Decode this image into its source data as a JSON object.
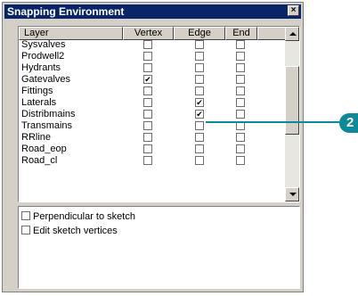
{
  "window": {
    "title": "Snapping Environment",
    "close_label": "×"
  },
  "columns": [
    "Layer",
    "Vertex",
    "Edge",
    "End"
  ],
  "layers": [
    {
      "name": "Sysvalves",
      "vertex": false,
      "edge": false,
      "end": false
    },
    {
      "name": "Prodwell2",
      "vertex": false,
      "edge": false,
      "end": false
    },
    {
      "name": "Hydrants",
      "vertex": false,
      "edge": false,
      "end": false
    },
    {
      "name": "Gatevalves",
      "vertex": true,
      "edge": false,
      "end": false
    },
    {
      "name": "Fittings",
      "vertex": false,
      "edge": false,
      "end": false
    },
    {
      "name": "Laterals",
      "vertex": false,
      "edge": true,
      "end": false
    },
    {
      "name": "Distribmains",
      "vertex": false,
      "edge": true,
      "end": false
    },
    {
      "name": "Transmains",
      "vertex": false,
      "edge": false,
      "end": false
    },
    {
      "name": "RRline",
      "vertex": false,
      "edge": false,
      "end": false
    },
    {
      "name": "Road_eop",
      "vertex": false,
      "edge": false,
      "end": false
    },
    {
      "name": "Road_cl",
      "vertex": false,
      "edge": false,
      "end": false
    }
  ],
  "options": [
    {
      "label": "Perpendicular to sketch",
      "checked": false
    },
    {
      "label": "Edit sketch vertices",
      "checked": false
    }
  ],
  "callout": {
    "number": "2",
    "color": "#0d8a9a"
  },
  "colors": {
    "titlebar": "#0a246a",
    "dialog": "#d4d0c8"
  }
}
